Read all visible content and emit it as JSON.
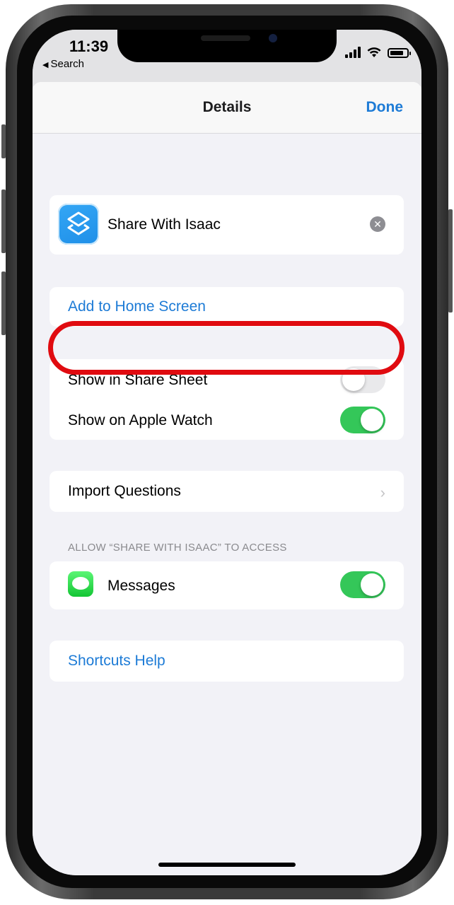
{
  "status_bar": {
    "time": "11:39",
    "back_label": "Search"
  },
  "nav": {
    "title": "Details",
    "done_label": "Done"
  },
  "shortcut": {
    "name": "Share With Isaac",
    "icon": "shortcuts-app-icon",
    "clear_icon": "clear-icon"
  },
  "actions": {
    "add_to_home": "Add to Home Screen"
  },
  "toggles": {
    "share_sheet": {
      "label": "Show in Share Sheet",
      "on": false
    },
    "apple_watch": {
      "label": "Show on Apple Watch",
      "on": true
    }
  },
  "import_questions": {
    "label": "Import Questions"
  },
  "access": {
    "header": "ALLOW “SHARE WITH ISAAC” TO ACCESS",
    "messages": {
      "label": "Messages",
      "on": true,
      "icon": "messages-app-icon"
    }
  },
  "help": {
    "label": "Shortcuts Help"
  },
  "colors": {
    "accent": "#1d7bd6",
    "toggle_on": "#34c759",
    "annotation_ring": "#e00b10"
  }
}
